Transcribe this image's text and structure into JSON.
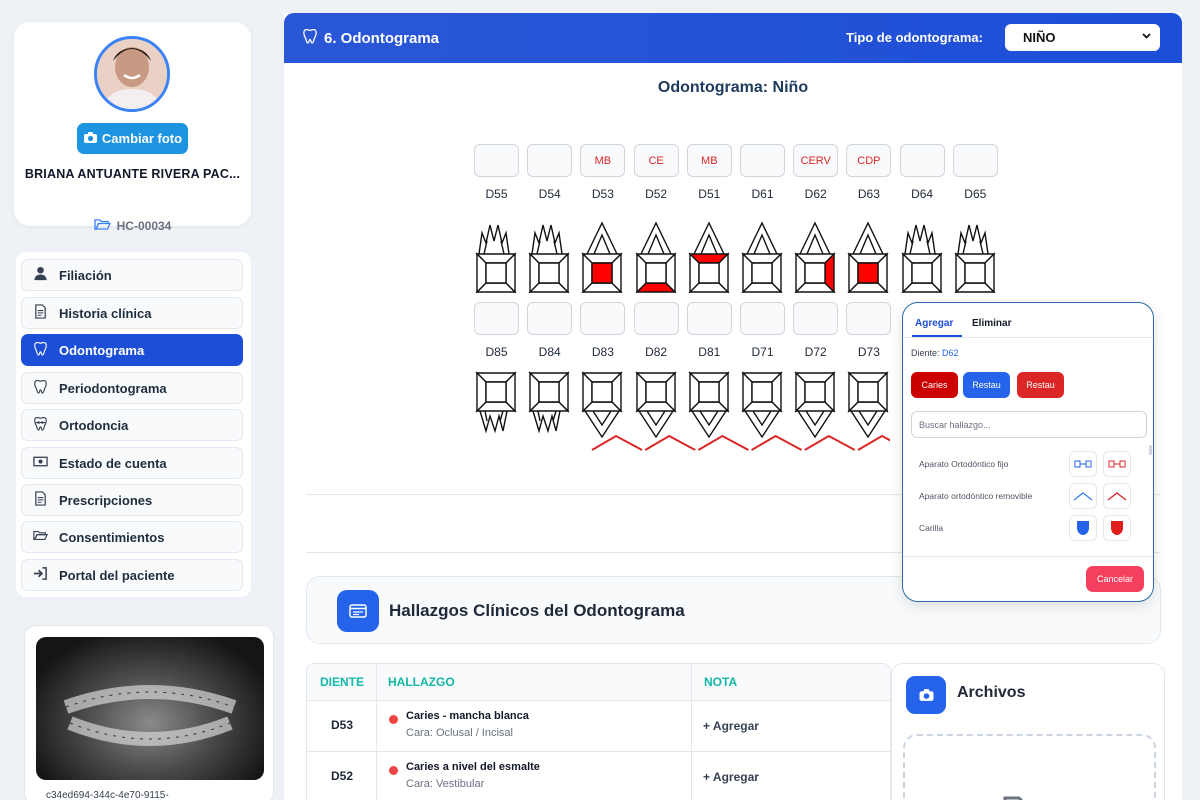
{
  "patient": {
    "name": "BRIANA ANTUANTE RIVERA PAC...",
    "hc": "HC-00034",
    "change_photo": "Cambiar foto"
  },
  "menu": [
    {
      "label": "Filiación",
      "icon": "user-icon"
    },
    {
      "label": "Historia clínica",
      "icon": "document-icon"
    },
    {
      "label": "Odontograma",
      "icon": "tooth-icon",
      "active": true
    },
    {
      "label": "Periodontograma",
      "icon": "tooth-icon"
    },
    {
      "label": "Ortodoncia",
      "icon": "braces-icon"
    },
    {
      "label": "Estado de cuenta",
      "icon": "money-icon"
    },
    {
      "label": "Prescripciones",
      "icon": "document-icon"
    },
    {
      "label": "Consentimientos",
      "icon": "folder-icon"
    },
    {
      "label": "Portal del paciente",
      "icon": "login-icon"
    }
  ],
  "xray_caption": "c34ed694-344c-4e70-9115-",
  "header": {
    "title": "6. Odontograma",
    "type_label": "Tipo de odontograma:",
    "type_value": "NIÑO"
  },
  "odontogram": {
    "title": "Odontograma: Niño",
    "upper": [
      {
        "id": "D55",
        "code": "",
        "fill": "none",
        "shape": "molar"
      },
      {
        "id": "D54",
        "code": "",
        "fill": "none",
        "shape": "molar"
      },
      {
        "id": "D53",
        "code": "MB",
        "fill": "center",
        "shape": "canine"
      },
      {
        "id": "D52",
        "code": "CE",
        "fill": "bottom",
        "shape": "canine"
      },
      {
        "id": "D51",
        "code": "MB",
        "fill": "top",
        "shape": "canine"
      },
      {
        "id": "D61",
        "code": "",
        "fill": "none",
        "shape": "canine"
      },
      {
        "id": "D62",
        "code": "CERV",
        "fill": "right",
        "shape": "canine"
      },
      {
        "id": "D63",
        "code": "CDP",
        "fill": "center",
        "shape": "canine"
      },
      {
        "id": "D64",
        "code": "",
        "fill": "none",
        "shape": "molar"
      },
      {
        "id": "D65",
        "code": "",
        "fill": "none",
        "shape": "molar"
      }
    ],
    "lower": [
      {
        "id": "D85",
        "code": "",
        "shape": "molar"
      },
      {
        "id": "D84",
        "code": "",
        "shape": "molar"
      },
      {
        "id": "D83",
        "code": "",
        "shape": "canine"
      },
      {
        "id": "D82",
        "code": "",
        "shape": "canine"
      },
      {
        "id": "D81",
        "code": "",
        "shape": "canine"
      },
      {
        "id": "D71",
        "code": "",
        "shape": "canine"
      },
      {
        "id": "D72",
        "code": "",
        "shape": "canine"
      },
      {
        "id": "D73",
        "code": "",
        "shape": "canine"
      }
    ],
    "fill_color": "#ff0000",
    "appliance_color": "#dc2626"
  },
  "findings": {
    "title": "Hallazgos Clínicos del Odontograma",
    "columns": [
      "DIENTE",
      "HALLAZGO",
      "NOTA"
    ],
    "rows": [
      {
        "tooth": "D53",
        "finding": "Caries - mancha blanca",
        "face": "Cara: Oclusal / Incisal",
        "note": "+ Agregar"
      },
      {
        "tooth": "D52",
        "finding": "Caries a nivel del esmalte",
        "face": "Cara: Vestibular",
        "note": "+ Agregar"
      }
    ]
  },
  "files": {
    "title": "Archivos"
  },
  "popup": {
    "tab_add": "Agregar",
    "tab_remove": "Eliminar",
    "tooth_label": "Diente:",
    "tooth_value": "D62",
    "buttons": [
      "Caries",
      "Restau",
      "Restau"
    ],
    "search_placeholder": "Buscar hallazgo...",
    "options": [
      "Aparato Ortodóntico fijo",
      "Aparato ortodóntico removible",
      "Carilla"
    ],
    "cancel": "Cancelar"
  }
}
